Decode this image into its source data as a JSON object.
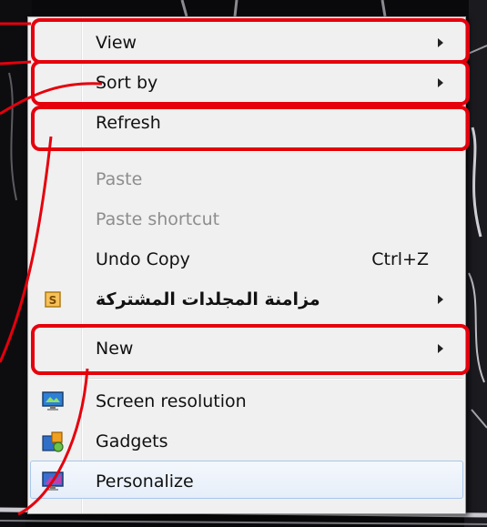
{
  "menu": {
    "items": [
      {
        "label": "View",
        "has_submenu": true,
        "disabled": false,
        "icon": "",
        "shortcut": ""
      },
      {
        "label": "Sort by",
        "has_submenu": true,
        "disabled": false,
        "icon": "",
        "shortcut": ""
      },
      {
        "label": "Refresh",
        "has_submenu": false,
        "disabled": false,
        "icon": "",
        "shortcut": ""
      },
      {
        "label": "Paste",
        "has_submenu": false,
        "disabled": true,
        "icon": "",
        "shortcut": ""
      },
      {
        "label": "Paste shortcut",
        "has_submenu": false,
        "disabled": true,
        "icon": "",
        "shortcut": ""
      },
      {
        "label": "Undo Copy",
        "has_submenu": false,
        "disabled": false,
        "icon": "",
        "shortcut": "Ctrl+Z"
      },
      {
        "label": "مزامنة المجلدات المشتركة",
        "has_submenu": true,
        "disabled": false,
        "icon": "shared-folder-sync-icon",
        "shortcut": ""
      },
      {
        "label": "New",
        "has_submenu": true,
        "disabled": false,
        "icon": "",
        "shortcut": ""
      },
      {
        "label": "Screen resolution",
        "has_submenu": false,
        "disabled": false,
        "icon": "monitor-icon",
        "shortcut": ""
      },
      {
        "label": "Gadgets",
        "has_submenu": false,
        "disabled": false,
        "icon": "gadgets-icon",
        "shortcut": ""
      },
      {
        "label": "Personalize",
        "has_submenu": false,
        "disabled": false,
        "icon": "personalize-icon",
        "shortcut": ""
      }
    ],
    "hovered_item": "Personalize"
  },
  "colors": {
    "highlight_red": "#e5000c",
    "menu_bg": "#f0f0f0",
    "disabled_text": "#8d8d8d"
  }
}
